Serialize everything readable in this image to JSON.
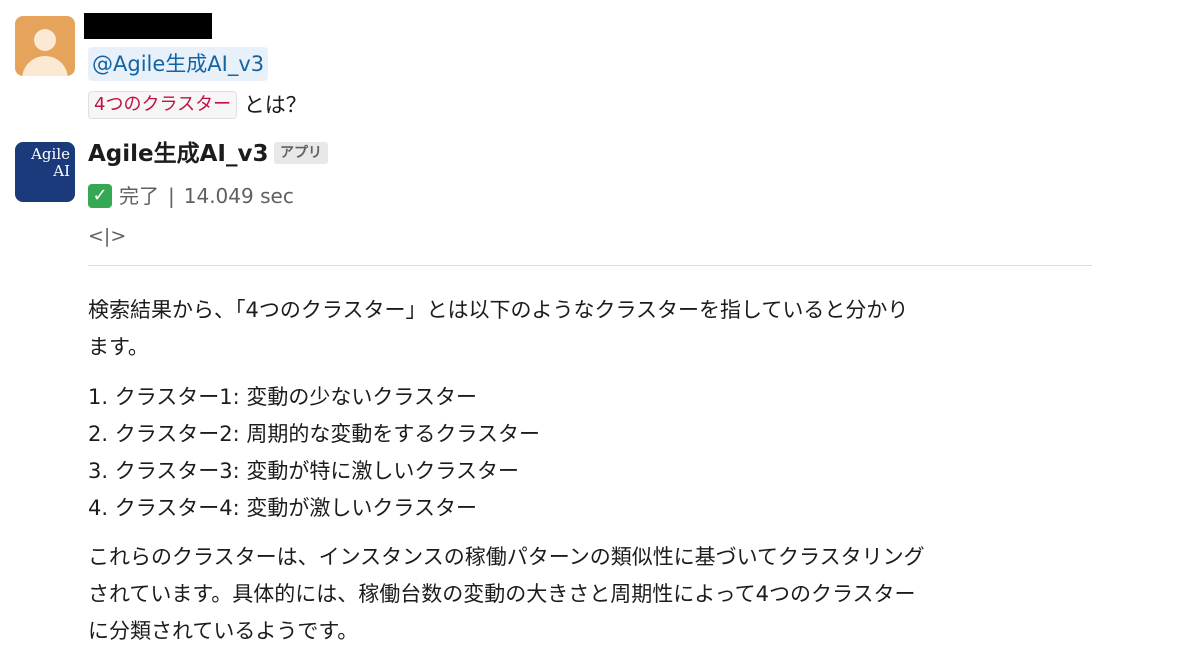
{
  "user_message": {
    "mention": "@Agile生成AI_v3",
    "code_term": "4つのクラスター",
    "suffix": "とは？"
  },
  "bot_message": {
    "avatar_line1": "Agile",
    "avatar_line2": "AI",
    "name": "Agile生成AI_v3",
    "badge": "アプリ",
    "status_label": "完了",
    "status_sep": "|",
    "elapsed": "14.049 sec",
    "code_tag": "<|>",
    "intro_line1": "検索結果から、「4つのクラスター」とは以下のようなクラスターを指していると分かり",
    "intro_line2": "ます。",
    "list": [
      "1. クラスター1: 変動の少ないクラスター",
      "2. クラスター2: 周期的な変動をするクラスター",
      "3. クラスター3: 変動が特に激しいクラスター",
      "4. クラスター4: 変動が激しいクラスター"
    ],
    "outro_line1": "これらのクラスターは、インスタンスの稼働パターンの類似性に基づいてクラスタリング",
    "outro_line2": "されています。具体的には、稼働台数の変動の大きさと周期性によって4つのクラスター",
    "outro_line3": "に分類されているようです。"
  },
  "icons": {
    "user_avatar": "user-silhouette-icon",
    "check": "check-mark-icon"
  },
  "colors": {
    "mention_bg": "#e8f1fa",
    "mention_text": "#1264a3",
    "code_text": "#c01343",
    "check_bg": "#34a853",
    "bot_avatar_bg": "#1b3a7b",
    "user_avatar_bg": "#e6a35c"
  }
}
